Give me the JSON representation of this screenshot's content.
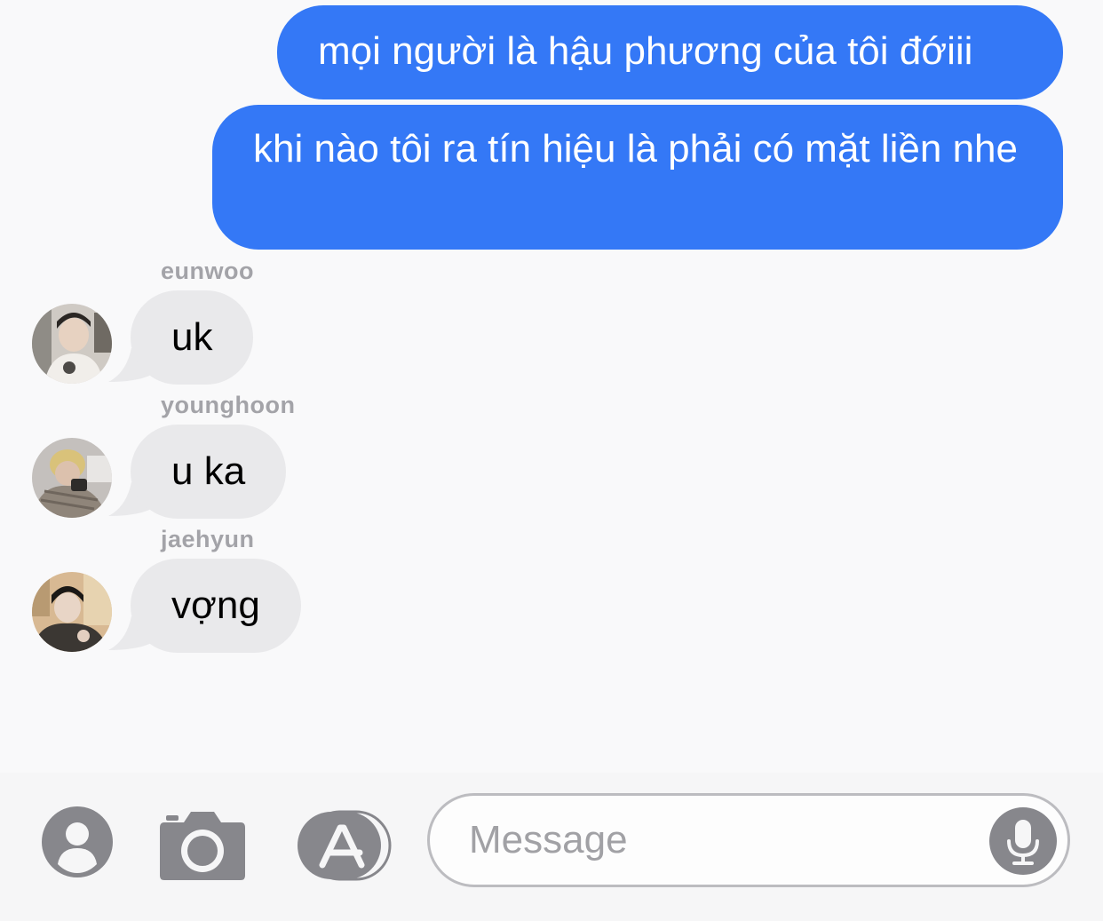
{
  "thread": {
    "outgoing": [
      {
        "text": "mọi người là hậu phương của tôi đớiii"
      },
      {
        "text": "khi nào tôi ra tín hiệu là phải có mặt liền nhe"
      }
    ],
    "incoming": [
      {
        "sender": "eunwoo",
        "text": "uk"
      },
      {
        "sender": "younghoon",
        "text": "u ka"
      },
      {
        "sender": "jaehyun",
        "text": "vợng"
      }
    ]
  },
  "composer": {
    "placeholder": "Message",
    "icons": [
      "contact-icon",
      "camera-icon",
      "app-store-icon",
      "microphone-icon"
    ]
  },
  "colors": {
    "outgoing_bubble": "#3478f6",
    "incoming_bubble": "#e9e9eb",
    "sender_label": "#a3a3a8",
    "icon_gray": "#87878c"
  }
}
